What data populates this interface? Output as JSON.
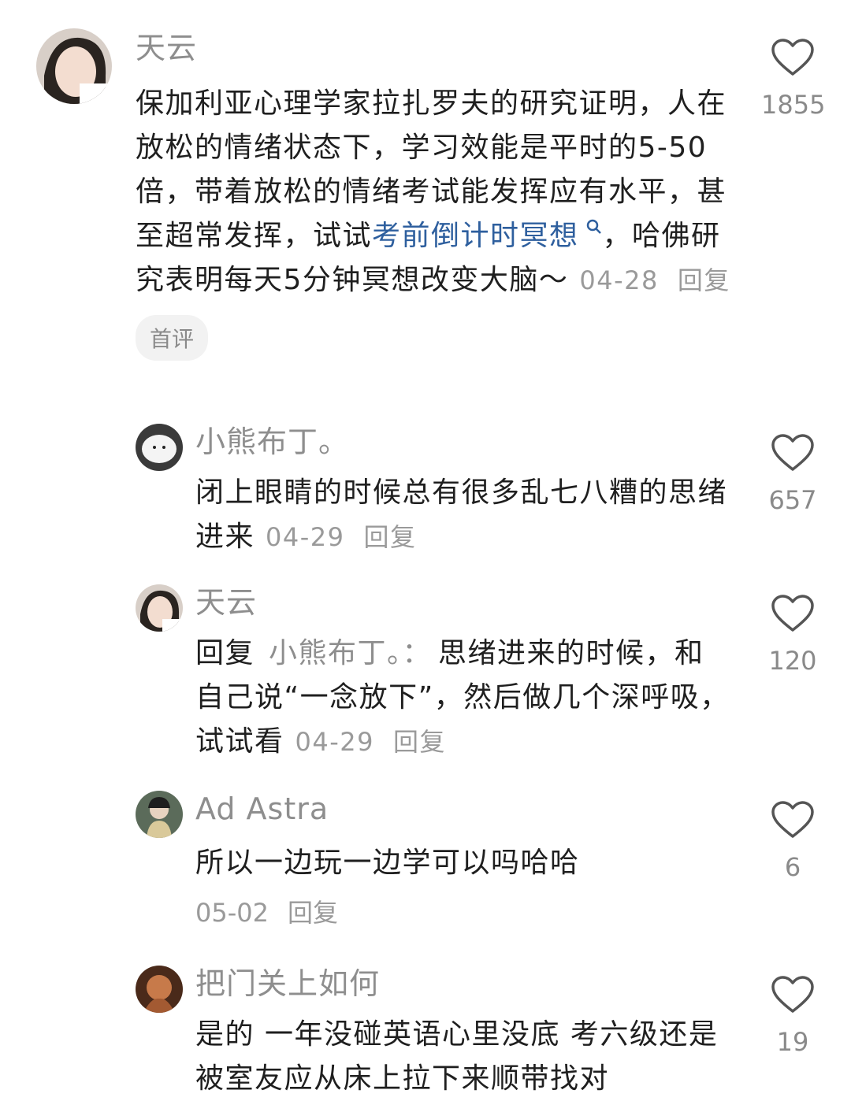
{
  "comments": [
    {
      "username": "天云",
      "text_before": "保加利亚心理学家拉扎罗夫的研究证明，人在放松的情绪状态下，学习效能是平时的5-50倍，带着放松的情绪考试能发挥应有水平，甚至超常发挥，试试",
      "link": "考前倒计时冥想",
      "text_after": "，哈佛研究表明每天5分钟冥想改变大脑～",
      "date": "04-28",
      "reply_label": "回复",
      "badge": "首评",
      "likes": "1855"
    },
    {
      "username": "小熊布丁。",
      "text": "闭上眼睛的时候总有很多乱七八糟的思绪进来",
      "date": "04-29",
      "reply_label": "回复",
      "likes": "657"
    },
    {
      "username": "天云",
      "reply_prefix": "回复",
      "reply_to": "小熊布丁。：",
      "text": "思绪进来的时候，和自己说“一念放下”，然后做几个深呼吸，试试看",
      "date": "04-29",
      "reply_label": "回复",
      "likes": "120"
    },
    {
      "username": "Ad Astra",
      "text": "所以一边玩一边学可以吗哈哈",
      "date": "05-02",
      "reply_label": "回复",
      "likes": "6"
    },
    {
      "username": "把门关上如何",
      "text": "是的 一年没碰英语心里没底 考六级还是被室友应从床上拉下来顺带找对",
      "likes": "19"
    }
  ],
  "icons": {
    "like": "heart-outline-icon",
    "search": "search-icon"
  },
  "colors": {
    "link": "#2e5f9e",
    "meta": "#9a9a9a",
    "badge_bg": "#f2f2f2"
  }
}
